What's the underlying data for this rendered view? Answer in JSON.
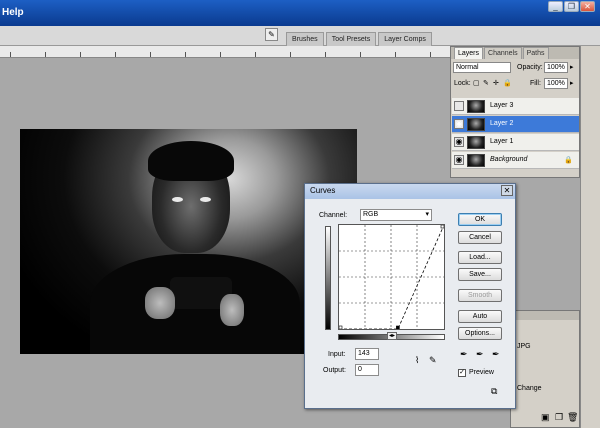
{
  "menubar": {
    "help_label": "Help",
    "window_buttons": [
      "minimize",
      "restore",
      "close"
    ]
  },
  "options_bar": {
    "tool_icon": "brush-preset-icon",
    "tabs": [
      "Brushes",
      "Tool Presets",
      "Layer Comps"
    ]
  },
  "layers_panel": {
    "tabs": [
      "Layers",
      "Channels",
      "Paths"
    ],
    "blend_mode": "Normal",
    "opacity_label": "Opacity:",
    "opacity_value": "100%",
    "lock_label": "Lock:",
    "fill_label": "Fill:",
    "fill_value": "100%",
    "layers": [
      {
        "name": "Layer 3",
        "visible": false,
        "selected": false
      },
      {
        "name": "Layer 2",
        "visible": true,
        "selected": true
      },
      {
        "name": "Layer 1",
        "visible": true,
        "selected": false
      },
      {
        "name": "Background",
        "visible": true,
        "selected": false
      }
    ]
  },
  "history_panel": {
    "items": [
      "JPG",
      "Change"
    ]
  },
  "curves_dialog": {
    "title": "Curves",
    "channel_label": "Channel:",
    "channel_value": "RGB",
    "input_label": "Input:",
    "input_value": "143",
    "output_label": "Output:",
    "output_value": "0",
    "buttons": {
      "ok": "OK",
      "cancel": "Cancel",
      "load": "Load...",
      "save": "Save...",
      "smooth": "Smooth",
      "auto": "Auto",
      "options": "Options..."
    },
    "preview_label": "Preview",
    "preview_checked": true,
    "curve_points": [
      {
        "input": 0,
        "output": 0
      },
      {
        "input": 143,
        "output": 0
      },
      {
        "input": 255,
        "output": 255
      }
    ]
  }
}
